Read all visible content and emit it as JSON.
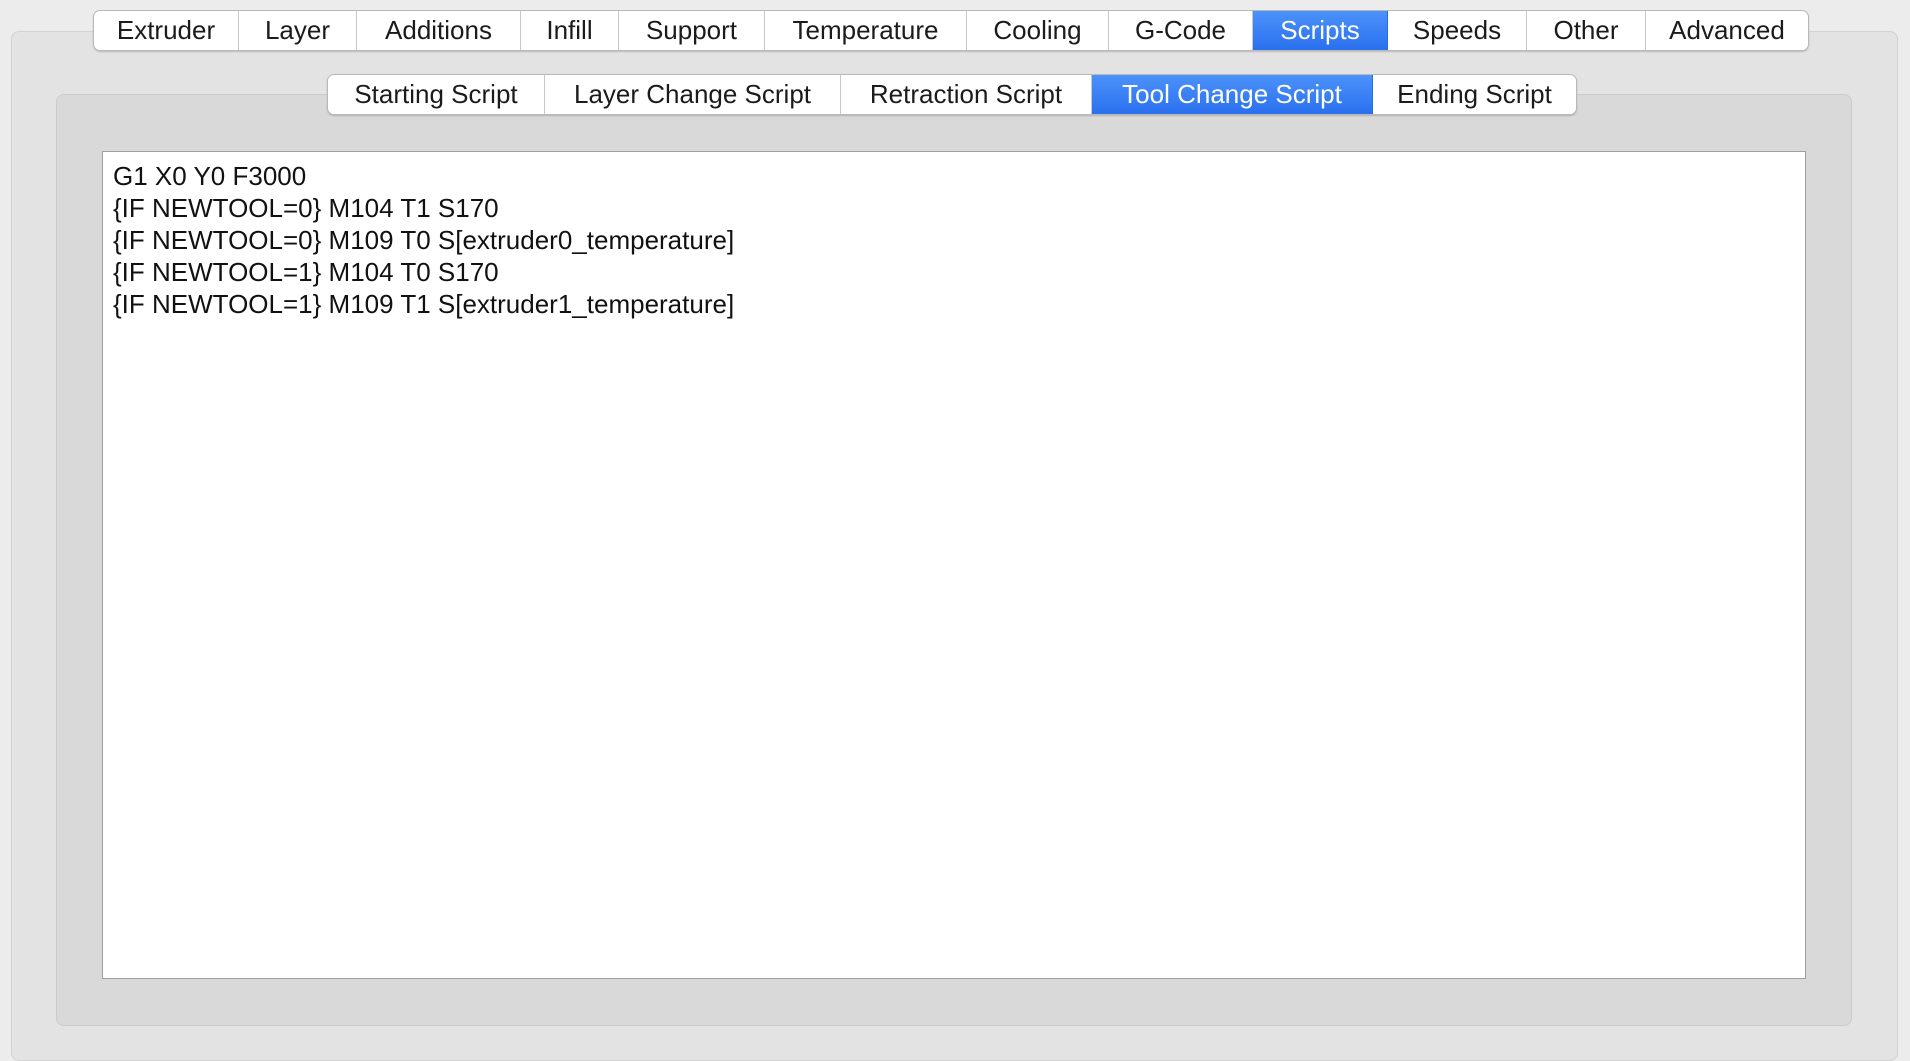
{
  "main_tabs": [
    {
      "label": "Extruder",
      "active": false
    },
    {
      "label": "Layer",
      "active": false
    },
    {
      "label": "Additions",
      "active": false
    },
    {
      "label": "Infill",
      "active": false
    },
    {
      "label": "Support",
      "active": false
    },
    {
      "label": "Temperature",
      "active": false
    },
    {
      "label": "Cooling",
      "active": false
    },
    {
      "label": "G-Code",
      "active": false
    },
    {
      "label": "Scripts",
      "active": true
    },
    {
      "label": "Speeds",
      "active": false
    },
    {
      "label": "Other",
      "active": false
    },
    {
      "label": "Advanced",
      "active": false
    }
  ],
  "sub_tabs": [
    {
      "label": "Starting Script",
      "active": false
    },
    {
      "label": "Layer Change Script",
      "active": false
    },
    {
      "label": "Retraction Script",
      "active": false
    },
    {
      "label": "Tool Change Script",
      "active": true
    },
    {
      "label": "Ending Script",
      "active": false
    }
  ],
  "script_editor": {
    "lines": [
      "G1 X0 Y0 F3000",
      "{IF NEWTOOL=0} M104 T1 S170",
      "{IF NEWTOOL=0} M109 T0 S[extruder0_temperature]",
      "{IF NEWTOOL=1} M104 T0 S170",
      "{IF NEWTOOL=1} M109 T1 S[extruder1_temperature]"
    ]
  },
  "colors": {
    "accent": "#3b82f6",
    "background": "#ececec"
  }
}
